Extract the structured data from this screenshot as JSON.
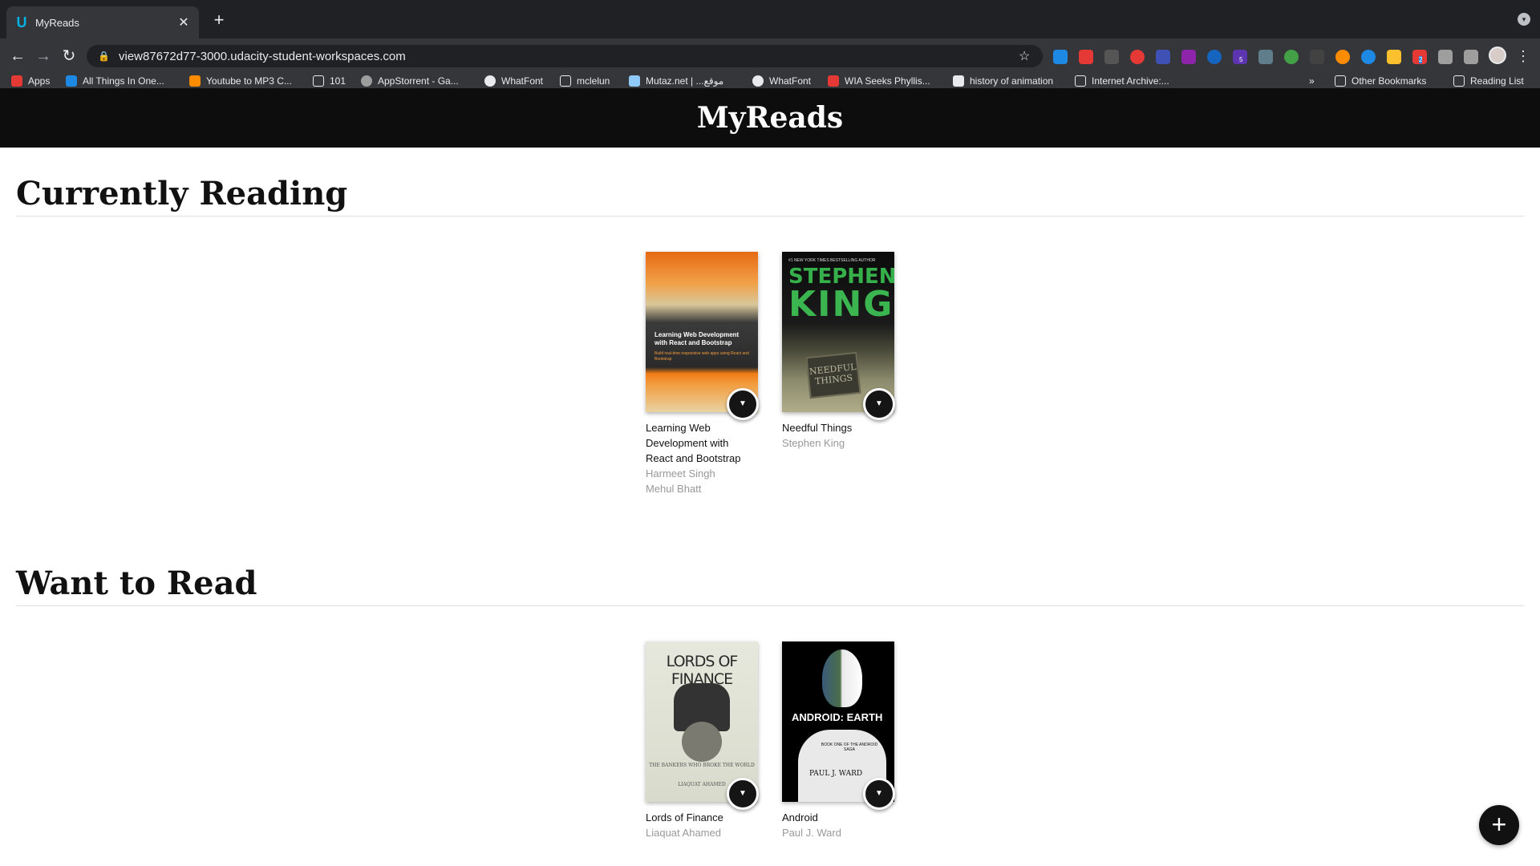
{
  "browser": {
    "tab_title": "MyReads",
    "tab_favicon": "U",
    "tab_close": "✕",
    "new_tab": "+",
    "url": "view87672d77-3000.udacity-student-workspaces.com",
    "bookmarks": [
      "Apps",
      "All Things In One...",
      "Youtube to MP3 C...",
      "101",
      "AppStorrent - Ga...",
      "WhatFont",
      "mclelun",
      "Mutaz.net | ...موقع",
      "WhatFont",
      "WIA Seeks Phyllis...",
      "history of animation",
      "Internet Archive:...",
      "Other Bookmarks",
      "Reading List"
    ],
    "bookmarks_overflow": "»",
    "ext_badges": [
      "5",
      "2"
    ]
  },
  "app": {
    "title": "MyReads",
    "add_button": "+"
  },
  "shelves": [
    {
      "title": "Currently Reading",
      "books": [
        {
          "title": "Learning Web Development with React and Bootstrap",
          "authors": [
            "Harmeet Singh",
            "Mehul Bhatt"
          ],
          "cover_text": "Learning Web Development with React and Bootstrap",
          "cover_sub": "Build real-time responsive web apps using React and Bootstrap"
        },
        {
          "title": "Needful Things",
          "authors": [
            "Stephen King"
          ],
          "cover_tag": "#1 NEW YORK TIMES BESTSELLING AUTHOR",
          "cover_line1": "STEPHEN",
          "cover_line2": "KING",
          "cover_sign": "NEEDFUL THINGS"
        }
      ]
    },
    {
      "title": "Want to Read",
      "books": [
        {
          "title": "Lords of Finance",
          "authors": [
            "Liaquat Ahamed"
          ],
          "cover_title": "LORDS OF FINANCE",
          "cover_sub": "THE BANKERS WHO BROKE THE WORLD",
          "cover_author": "LIAQUAT AHAMED"
        },
        {
          "title": "Android",
          "authors": [
            "Paul J. Ward"
          ],
          "cover_title": "ANDROID: EARTH",
          "cover_sub": "BOOK ONE OF THE ANDROID SAGA",
          "cover_author": "PAUL J. WARD"
        }
      ]
    }
  ],
  "shelf_changer_icon": "▼"
}
